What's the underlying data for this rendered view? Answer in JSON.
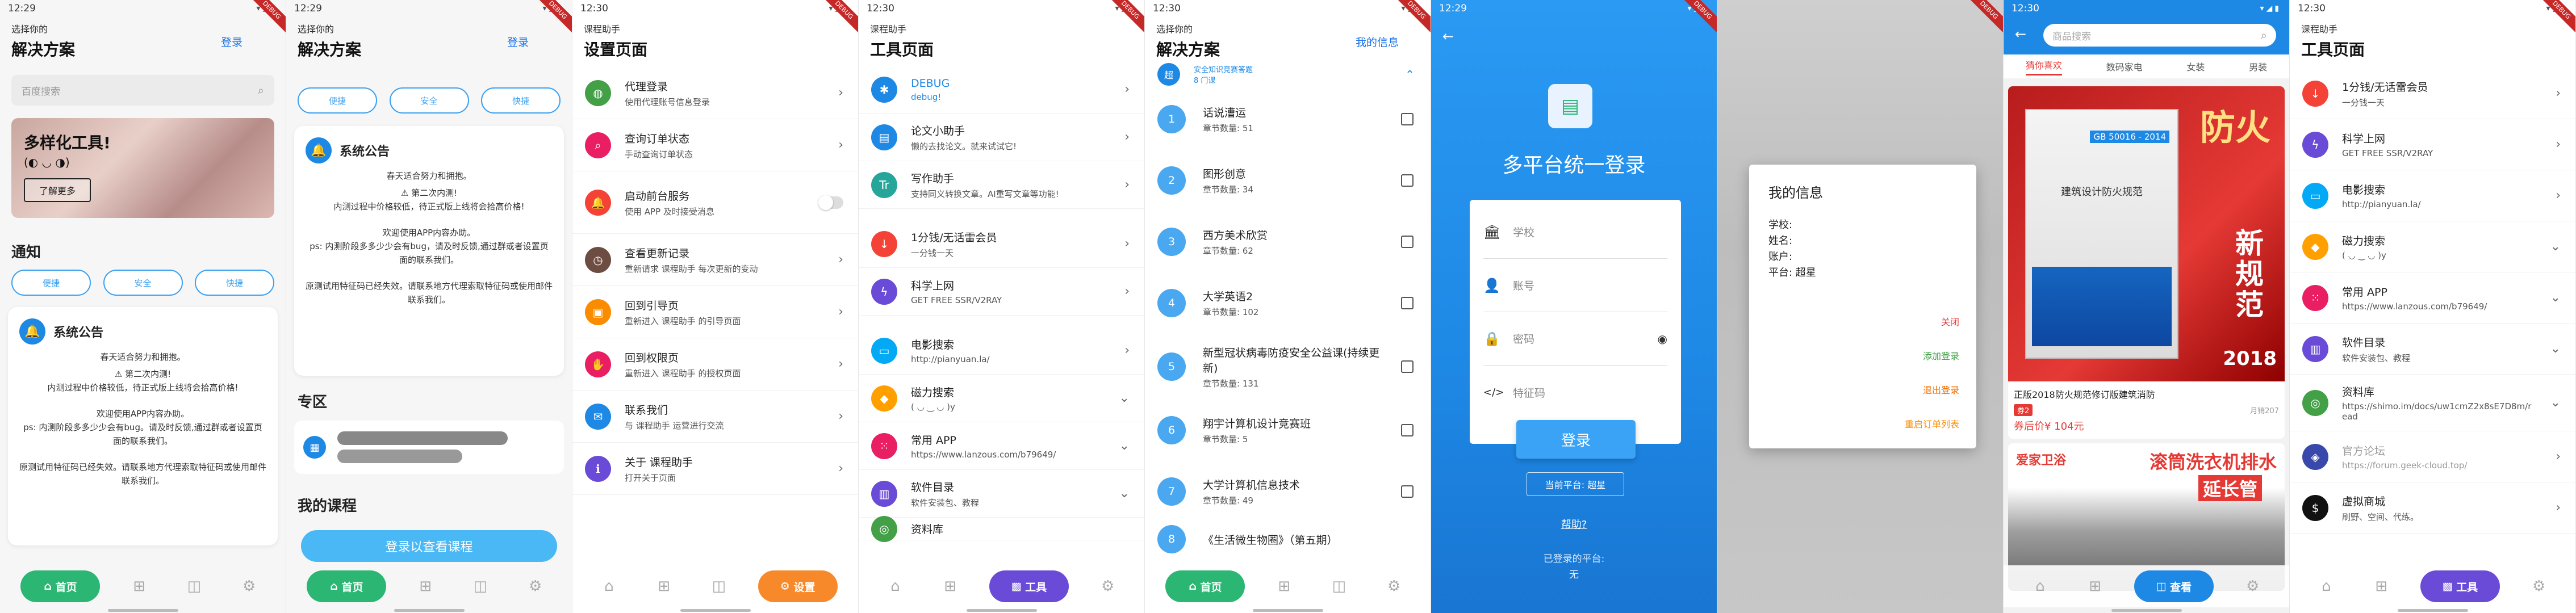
{
  "s1": {
    "time": "12:29",
    "subtitle": "选择你的",
    "title": "解决方案",
    "login": "登录",
    "search_placeholder": "百度搜索",
    "banner_title": "多样化工具!",
    "banner_face": "(◐ ◡ ◑)",
    "banner_btn": "了解更多",
    "section": "通知",
    "pills": [
      "便捷",
      "安全",
      "快捷"
    ],
    "notice_title": "系统公告",
    "notice_lines": [
      "春天适合努力和拥抱。",
      "⚠ 第二次内测!",
      "内测过程中价格较低，待正式版上线将会拾高价格!",
      "欢迎使用APP内容办助。",
      "ps: 内测阶段多多少少会有bug。请及时反馈,通过群或者设置页面的联系我们。",
      "原测试用特征码已经失效。请联系地方代理索取特征码或使用邮件联系我们。"
    ],
    "tabs": {
      "home": "首页"
    }
  },
  "s2": {
    "time": "12:29",
    "subtitle": "选择你的",
    "title": "解决方案",
    "login": "登录",
    "pills": [
      "便捷",
      "安全",
      "快捷"
    ],
    "notice_title": "系统公告",
    "notice_lines": [
      "春天适合努力和拥抱。",
      "⚠ 第二次内测!",
      "内测过程中价格较低，待正式版上线将会拾高价格!",
      "欢迎使用APP内容办助。",
      "ps: 内测阶段多多少少会有bug，请及时反馈,通过群或者设置页面的联系我们。",
      "原测试用特征码已经失效。请联系地方代理索取特征码或使用邮件联系我们。"
    ],
    "zone": "专区",
    "my_course": "我的课程",
    "login_course": "登录以查看课程",
    "tabs": {
      "home": "首页"
    }
  },
  "s3": {
    "time": "12:30",
    "subtitle": "课程助手",
    "title": "设置页面",
    "rows": [
      {
        "t": "代理登录",
        "d": "使用代理账号信息登录"
      },
      {
        "t": "查询订单状态",
        "d": "手动查询订单状态"
      },
      {
        "t": "启动前台服务",
        "d": "使用 APP 及时接受消息"
      },
      {
        "t": "查看更新记录",
        "d": "重新请求 课程助手 每次更新的变动"
      },
      {
        "t": "回到引导页",
        "d": "重新进入 课程助手 的引导页面"
      },
      {
        "t": "回到权限页",
        "d": "重新进入 课程助手 的授权页面"
      },
      {
        "t": "联系我们",
        "d": "与 课程助手 运营进行交流"
      },
      {
        "t": "关于 课程助手",
        "d": "打开关于页面"
      }
    ],
    "tabs": {
      "settings": "设置"
    }
  },
  "s4": {
    "time": "12:30",
    "subtitle": "课程助手",
    "title": "工具页面",
    "rows": [
      {
        "t": "DEBUG",
        "d": "debug!"
      },
      {
        "t": "论文小助手",
        "d": "懒的去找论文。就来试试它!"
      },
      {
        "t": "写作助手",
        "d": "支持同义转换文章。AI重写文章等功能!"
      },
      {
        "t": "1分钱/无话雷会员",
        "d": "一分钱一天"
      },
      {
        "t": "科学上网",
        "d": "GET FREE SSR/V2RAY"
      },
      {
        "t": "电影搜索",
        "d": "http://pianyuan.la/"
      },
      {
        "t": "磁力搜索",
        "d": "( ◡ ‿ ◡ )y"
      },
      {
        "t": "常用 APP",
        "d": "https://www.lanzous.com/b79649/"
      },
      {
        "t": "软件目录",
        "d": "软件安装包、教程"
      },
      {
        "t": "资料库",
        "d": ""
      }
    ],
    "tabs": {
      "tools": "工具"
    }
  },
  "s5": {
    "time": "12:30",
    "subtitle": "选择你的",
    "title": "解决方案",
    "myinfo": "我的信息",
    "header_t": "安全知识竞赛答题",
    "header_d": "8 门课",
    "items": [
      {
        "n": "1",
        "t": "话说漕运",
        "d": "章节数量: 51"
      },
      {
        "n": "2",
        "t": "图形创意",
        "d": "章节数量: 34"
      },
      {
        "n": "3",
        "t": "西方美术欣赏",
        "d": "章节数量: 62"
      },
      {
        "n": "4",
        "t": "大学英语2",
        "d": "章节数量: 102"
      },
      {
        "n": "5",
        "t": "新型冠状病毒防疫安全公益课(持续更新)",
        "d": "章节数量: 131"
      },
      {
        "n": "6",
        "t": "翔宇计算机设计竞赛班",
        "d": "章节数量: 5"
      },
      {
        "n": "7",
        "t": "大学计算机信息技术",
        "d": "章节数量: 49"
      },
      {
        "n": "8",
        "t": "《生活微生物圈》（第五期）",
        "d": ""
      }
    ],
    "tabs": {
      "home": "首页"
    }
  },
  "s6": {
    "time": "12:29",
    "title": "多平台统一登录",
    "school": "学校",
    "account": "账号",
    "password": "密码",
    "code": "特征码",
    "login": "登录",
    "current": "当前平台: 超星",
    "help": "帮助?",
    "logged": "已登录的平台:",
    "none": "无"
  },
  "s7": {
    "title": "我的信息",
    "fields": [
      "学校:",
      "姓名:",
      "账户:",
      "平台: 超星"
    ],
    "actions": [
      "关闭",
      "添加登录",
      "退出登录",
      "重启订单列表"
    ]
  },
  "s8": {
    "time": "12:30",
    "search": "商品搜索",
    "cats": [
      "猜你喜欢",
      "数码家电",
      "女装",
      "男装"
    ],
    "book_title": "正版2018防火规范修订版建筑消防",
    "sold": "月销207",
    "tag": "券2",
    "price": "券后价¥ 104元",
    "ad_brand": "爱家卫浴",
    "ad_text1": "滚筒洗衣机排水",
    "ad_text2": "延长管",
    "book_big": "防火",
    "book_big2": "新规范",
    "book_year": "2018",
    "book_code": "GB 50016 - 2014",
    "book_cn": "建筑设计防火规范",
    "tabs": {
      "find": "查看"
    }
  },
  "s9": {
    "time": "12:30",
    "subtitle": "课程助手",
    "title": "工具页面",
    "rows": [
      {
        "t": "1分钱/无话雷会员",
        "d": "一分钱一天"
      },
      {
        "t": "科学上网",
        "d": "GET FREE SSR/V2RAY"
      },
      {
        "t": "电影搜索",
        "d": "http://pianyuan.la/"
      },
      {
        "t": "磁力搜索",
        "d": "( ◡ ‿ ◡ )y"
      },
      {
        "t": "常用 APP",
        "d": "https://www.lanzous.com/b79649/"
      },
      {
        "t": "软件目录",
        "d": "软件安装包、教程"
      },
      {
        "t": "资料库",
        "d": "https://shimo.im/docs/uw1cmZ2x8sE7D8m/read"
      },
      {
        "t": "官方论坛",
        "d": "https://forum.geek-cloud.top/"
      },
      {
        "t": "虚拟商城",
        "d": "刷野、空间、代练。"
      }
    ],
    "tabs": {
      "tools": "工具"
    }
  },
  "colors": {
    "green": "#2bb673",
    "blue": "#1e88e5",
    "orange": "#f7892a",
    "purple": "#6a4bd8"
  }
}
